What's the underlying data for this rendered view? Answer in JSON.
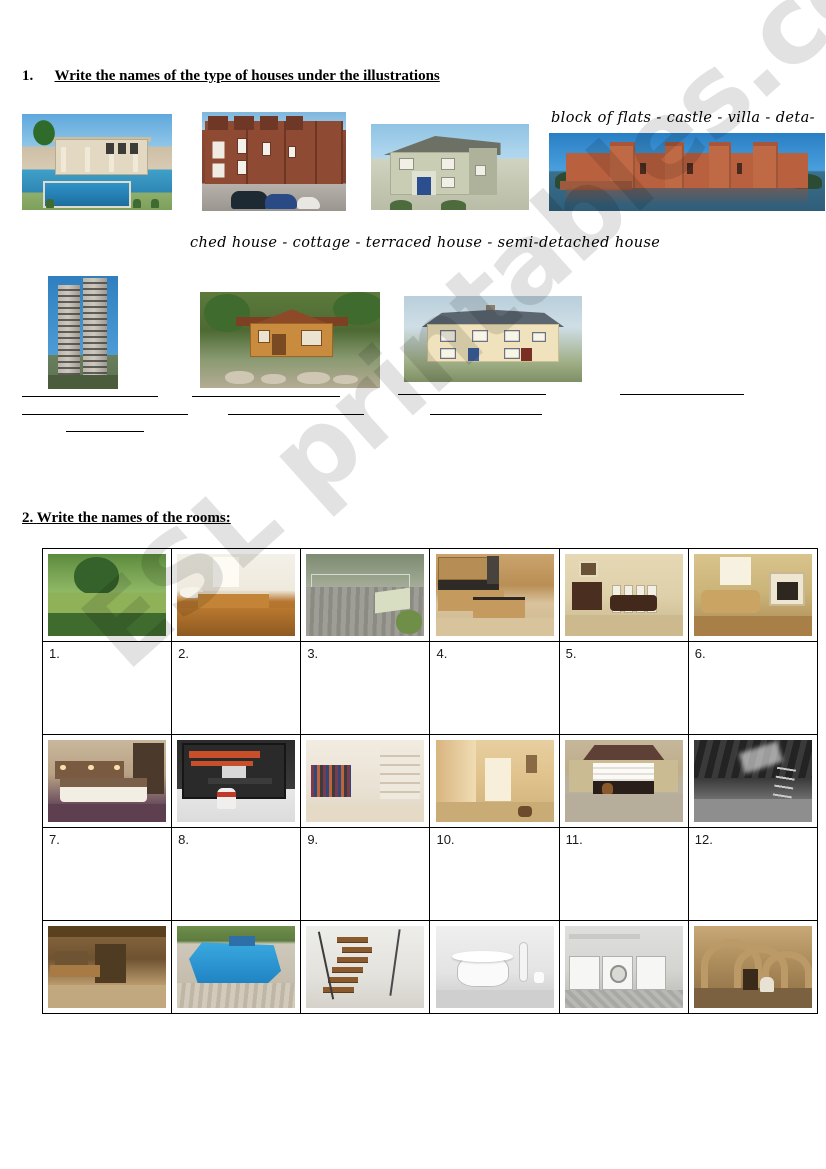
{
  "document": {
    "title": "Houses and Rooms vocabulary worksheet",
    "watermark": "ESL printables.com"
  },
  "section1": {
    "number": "1.",
    "title": "Write the names of the type of houses under the illustrations",
    "wordbank_line1": "block of flats - castle - villa - deta-",
    "wordbank_line2": "ched house - cottage - terraced house - semi-detached house",
    "house_images": [
      {
        "name": "villa-with-pool",
        "alt": "Large white villa with swimming pool and palm tree"
      },
      {
        "name": "terraced-houses",
        "alt": "Row of red brick terraced houses with parked cars"
      },
      {
        "name": "semi-detached-house",
        "alt": "Green rendered semi-detached house with blue door"
      },
      {
        "name": "castle",
        "alt": "Red brick castle with moat and towers"
      },
      {
        "name": "block-of-flats",
        "alt": "Two tall concrete tower blocks of flats"
      },
      {
        "name": "cottage",
        "alt": "Wooden log cottage surrounded by trees and rocks"
      },
      {
        "name": "detached-house",
        "alt": "Cream detached house with grey slate roof"
      }
    ],
    "answer_lines_count": 7
  },
  "section2": {
    "number": "2.",
    "title": "Write the names of the rooms:",
    "columns": 6,
    "rows": [
      {
        "type": "images",
        "cells": [
          {
            "name": "garden",
            "style": "r-garden",
            "alt": "Green garden with tree and lawn"
          },
          {
            "name": "bathroom",
            "style": "r-bath",
            "alt": "Bathroom with wooden bath and sink"
          },
          {
            "name": "terrace",
            "style": "r-terrace",
            "alt": "Wooden terrace with chair and plants"
          },
          {
            "name": "kitchen",
            "style": "r-kitchen",
            "alt": "Wooden kitchen with island and extractor hood"
          },
          {
            "name": "dining-room",
            "style": "r-dining",
            "alt": "Dining room with table, chairs and sideboard"
          },
          {
            "name": "living-room",
            "style": "r-living",
            "alt": "Living room with sofa and fireplace"
          }
        ]
      },
      {
        "type": "numbers",
        "cells": [
          {
            "label": "1."
          },
          {
            "label": "2."
          },
          {
            "label": "3."
          },
          {
            "label": "4."
          },
          {
            "label": "5."
          },
          {
            "label": "6."
          }
        ]
      },
      {
        "type": "images",
        "cells": [
          {
            "name": "bedroom",
            "style": "r-bedroom",
            "alt": "Bedroom with double bed and headboard"
          },
          {
            "name": "study",
            "style": "r-study",
            "alt": "Study with desk, laptop and shelving unit"
          },
          {
            "name": "dressing-room",
            "style": "r-closet",
            "alt": "Walk-in wardrobe with clothes rails and shelves"
          },
          {
            "name": "hall",
            "style": "r-hall",
            "alt": "Hallway with door and pictures"
          },
          {
            "name": "garage",
            "style": "r-garage",
            "alt": "Garage with open door, car and dog"
          },
          {
            "name": "attic",
            "style": "r-attic",
            "alt": "Black and white attic with ladder and rubble"
          }
        ]
      },
      {
        "type": "numbers",
        "cells": [
          {
            "label": "7."
          },
          {
            "label": "8."
          },
          {
            "label": "9."
          },
          {
            "label": "10."
          },
          {
            "label": "11."
          },
          {
            "label": "12."
          }
        ]
      },
      {
        "type": "images",
        "cells": [
          {
            "name": "basement",
            "style": "r-basement",
            "alt": "Basement workshop with workbench and shelves"
          },
          {
            "name": "swimming-pool",
            "style": "r-pool",
            "alt": "Blue swimming pool with wooden decking"
          },
          {
            "name": "staircase",
            "style": "r-stairs",
            "alt": "Modern open wooden staircase with metal rail"
          },
          {
            "name": "toilet",
            "style": "r-toilet",
            "alt": "White toilet with brush and paper roll"
          },
          {
            "name": "laundry-room",
            "style": "r-laundry",
            "alt": "Laundry room with washing machine and units"
          },
          {
            "name": "cellar",
            "style": "r-cellar",
            "alt": "Vaulted stone cellar with arches"
          }
        ]
      }
    ]
  }
}
